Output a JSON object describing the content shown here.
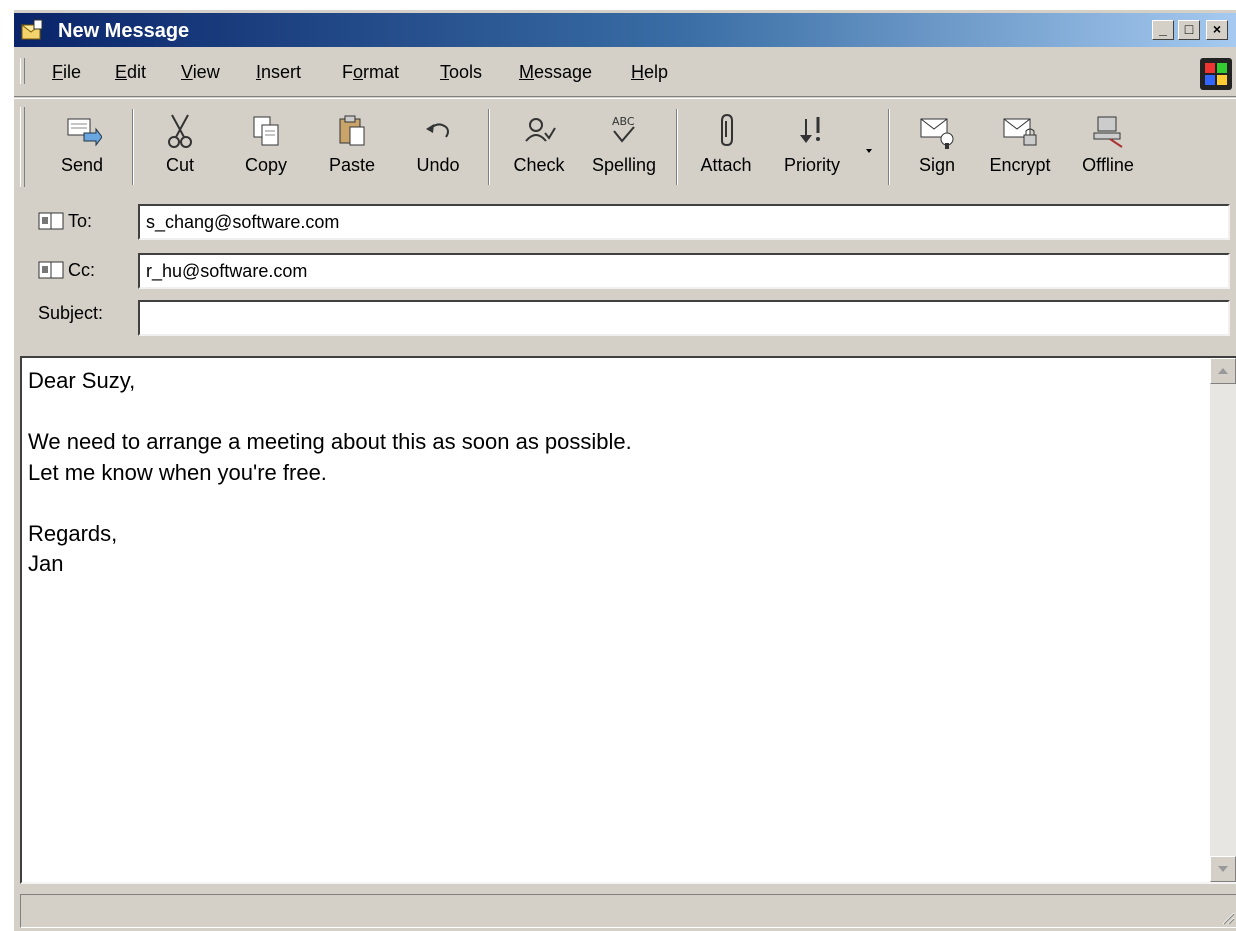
{
  "window": {
    "title": "New Message",
    "minimize": "_",
    "maximize": "□",
    "close": "×"
  },
  "menu": [
    {
      "label": "File",
      "accel": "F"
    },
    {
      "label": "Edit",
      "accel": "E"
    },
    {
      "label": "View",
      "accel": "V"
    },
    {
      "label": "Insert",
      "accel": "I"
    },
    {
      "label": "Format",
      "accel": "o"
    },
    {
      "label": "Tools",
      "accel": "T"
    },
    {
      "label": "Message",
      "accel": "M"
    },
    {
      "label": "Help",
      "accel": "H"
    }
  ],
  "toolbar": {
    "send": "Send",
    "cut": "Cut",
    "copy": "Copy",
    "paste": "Paste",
    "undo": "Undo",
    "check": "Check",
    "spelling": "Spelling",
    "attach": "Attach",
    "priority": "Priority",
    "sign": "Sign",
    "encrypt": "Encrypt",
    "offline": "Offline"
  },
  "fields": {
    "to_label": "To:",
    "to_value": "s_chang@software.com",
    "cc_label": "Cc:",
    "cc_value": "r_hu@software.com",
    "subject_label": "Subject:",
    "subject_value": ""
  },
  "message": {
    "lines": [
      "Dear Suzy,",
      "",
      "We need to arrange a meeting about this as soon as possible.",
      "Let me know when you're free.",
      "",
      "Regards,",
      "Jan"
    ]
  },
  "colors": {
    "chrome": "#d4d0c8",
    "title_start": "#0a246a",
    "title_end": "#a6caf0"
  }
}
